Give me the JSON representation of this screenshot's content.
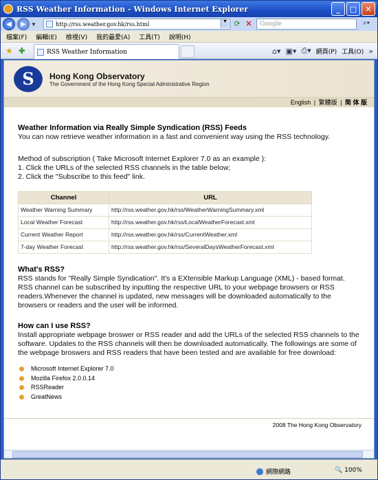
{
  "window": {
    "title": "RSS Weather Information - Windows Internet Explorer"
  },
  "address": {
    "url": "http://rss.weather.gov.hk/rss.html"
  },
  "search": {
    "placeholder": "Google"
  },
  "menu": [
    "檔案(F)",
    "編輯(E)",
    "檢視(V)",
    "我的最愛(A)",
    "工具(T)",
    "說明(H)"
  ],
  "tab": {
    "label": "RSS Weather Information"
  },
  "cmd": {
    "page": "網頁(P)",
    "tools": "工具(O)"
  },
  "header": {
    "org": "Hong Kong Observatory",
    "sub": "The Government of the Hong Kong Special Administrative Region"
  },
  "lang": {
    "en": "English",
    "sep1": " | ",
    "tc": "繁體版",
    "sep2": " | ",
    "sc": "简 体 版"
  },
  "main": {
    "heading": "Weather Information via Really Simple Syndication (RSS) Feeds",
    "intro": "You can now retrieve weather information in a fast and convenient way using the RSS technology.",
    "method": "Method of subscription ( Take Microsoft Internet Explorer 7.0 as an example ):",
    "step1": "1. Click the URLs of the selected RSS channels in the table below;",
    "step2": "2. Click the \"Subscribe to this feed\" link.",
    "table": {
      "headers": [
        "Channel",
        "URL"
      ],
      "rows": [
        [
          "Weather Warning Summary",
          "http://rss.weather.gov.hk/rss/WeatherWarningSummary.xml"
        ],
        [
          "Local Weather Forecast",
          "http://rss.weather.gov.hk/rss/LocalWeatherForecast.xml"
        ],
        [
          "Current Weather Report",
          "http://rss.weather.gov.hk/rss/CurrentWeather.xml"
        ],
        [
          "7-day Weather Forecast",
          "http://rss.weather.gov.hk/rss/SeveralDaysWeatherForecast.xml"
        ]
      ]
    },
    "what_heading": "What's RSS?",
    "what_text": "RSS stands for \"Really Simple Syndication\". It's a EXtensible Markup Language (XML) - based format. RSS channel can be subscribed by inputting the respective URL to your webpage browsers or RSS readers.Whenever the channel is updated, new messages will be downloaded automatically to the browsers or readers and the user will be informed.",
    "how_heading": "How can I use RSS?",
    "how_text": "Install appropriate webpage broswer or RSS reader and add the URLs of the selected RSS channels to the software. Updates to the RSS channels will then be downloaded automatically. The followings are some of the webpage broswers and RSS readers that have been tested and are available for free download:",
    "apps": [
      "Microsoft Internet Explorer 7.0",
      "Mozilla Firefox 2.0.0.14",
      "RSSReader",
      "GreatNews"
    ]
  },
  "footer": {
    "text": "2008 The Hong Kong Observatory"
  },
  "status": {
    "zone": "網際網路",
    "zoom": "100%"
  }
}
